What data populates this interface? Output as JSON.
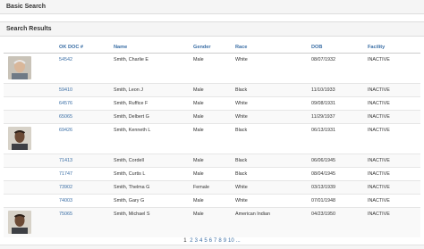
{
  "panels": {
    "basic_search_title": "Basic Search",
    "results_title": "Search Results"
  },
  "table": {
    "headers": [
      "OK DOC #",
      "Name",
      "Gender",
      "Race",
      "DOB",
      "Facility"
    ],
    "rows": [
      {
        "doc": "54542",
        "name": "Smith, Charlie E",
        "gender": "Male",
        "race": "White",
        "dob": "08/07/1932",
        "facility": "INACTIVE",
        "photo": "elderly-man-photo"
      },
      {
        "doc": "59410",
        "name": "Smith, Leon J",
        "gender": "Male",
        "race": "Black",
        "dob": "11/10/1933",
        "facility": "INACTIVE"
      },
      {
        "doc": "64576",
        "name": "Smith, Ruffice F",
        "gender": "Male",
        "race": "White",
        "dob": "09/08/1931",
        "facility": "INACTIVE"
      },
      {
        "doc": "65065",
        "name": "Smith, Delbert G",
        "gender": "Male",
        "race": "White",
        "dob": "11/29/1937",
        "facility": "INACTIVE"
      },
      {
        "doc": "69426",
        "name": "Smith, Kenneth L",
        "gender": "Male",
        "race": "Black",
        "dob": "06/13/1931",
        "facility": "INACTIVE",
        "photo": "man-photo"
      },
      {
        "doc": "71413",
        "name": "Smith, Cordell",
        "gender": "Male",
        "race": "Black",
        "dob": "06/06/1945",
        "facility": "INACTIVE"
      },
      {
        "doc": "71747",
        "name": "Smith, Curtis L",
        "gender": "Male",
        "race": "Black",
        "dob": "08/04/1945",
        "facility": "INACTIVE"
      },
      {
        "doc": "73902",
        "name": "Smith, Thelma G",
        "gender": "Female",
        "race": "White",
        "dob": "03/13/1939",
        "facility": "INACTIVE"
      },
      {
        "doc": "74003",
        "name": "Smith, Gary G",
        "gender": "Male",
        "race": "White",
        "dob": "07/01/1948",
        "facility": "INACTIVE"
      },
      {
        "doc": "75065",
        "name": "Smith, Michael S",
        "gender": "Male",
        "race": "American Indian",
        "dob": "04/23/1950",
        "facility": "INACTIVE",
        "photo": "man-photo"
      }
    ]
  },
  "pagination": {
    "current": "1",
    "pages": [
      "2",
      "3",
      "4",
      "5",
      "6",
      "7",
      "8",
      "9",
      "10"
    ],
    "more": "..."
  },
  "colors": {
    "link": "#3a6ea5",
    "header_bg": "#f5f5f5"
  }
}
